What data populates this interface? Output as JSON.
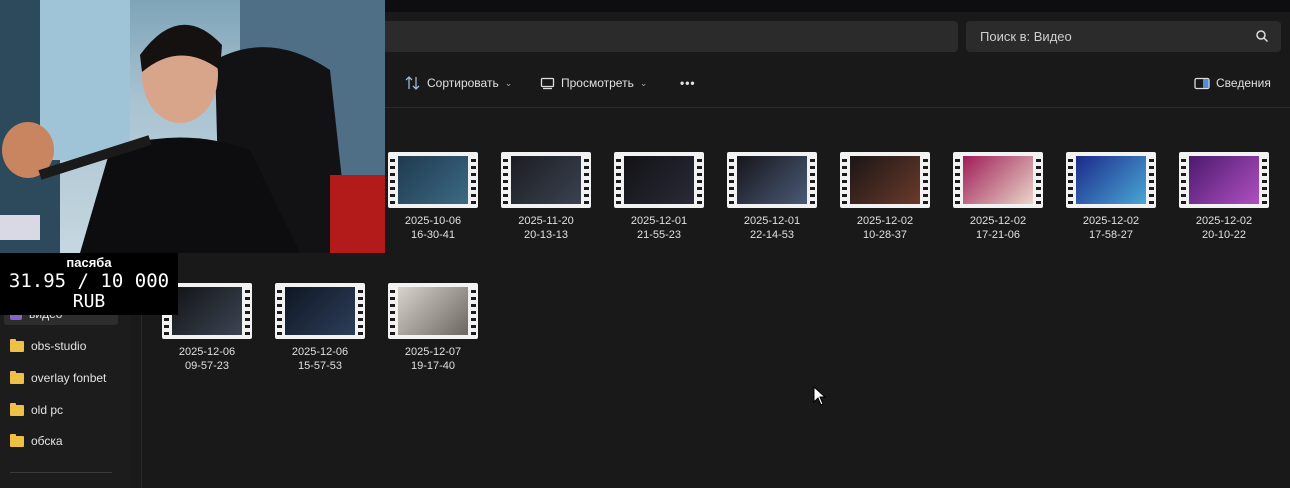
{
  "search": {
    "placeholder": "Поиск в: Видео"
  },
  "toolbar": {
    "sort_label": "Сортировать",
    "view_label": "Просмотреть",
    "more_label": "•••",
    "details_label": "Сведения"
  },
  "sidebar": {
    "items": [
      {
        "label": "видео",
        "icon": "video-folder-icon",
        "selected": true
      },
      {
        "label": "obs-studio",
        "icon": "folder-icon"
      },
      {
        "label": "overlay fonbet",
        "icon": "folder-icon"
      },
      {
        "label": "old pc",
        "icon": "folder-icon"
      },
      {
        "label": "обска",
        "icon": "folder-icon"
      }
    ]
  },
  "files": [
    {
      "date": "2025-10-06",
      "time": "16-30-41",
      "colors": [
        "#1f3a4f",
        "#3c6a84"
      ]
    },
    {
      "date": "2025-11-20",
      "time": "20-13-13",
      "colors": [
        "#1b1d22",
        "#3b4250"
      ]
    },
    {
      "date": "2025-12-01",
      "time": "21-55-23",
      "colors": [
        "#121216",
        "#2a2a38"
      ]
    },
    {
      "date": "2025-12-01",
      "time": "22-14-53",
      "colors": [
        "#16161c",
        "#4b5a76"
      ]
    },
    {
      "date": "2025-12-02",
      "time": "10-28-37",
      "colors": [
        "#1a1616",
        "#6b3a2a"
      ]
    },
    {
      "date": "2025-12-02",
      "time": "17-21-06",
      "colors": [
        "#a01c58",
        "#e9d6c8"
      ]
    },
    {
      "date": "2025-12-02",
      "time": "17-58-27",
      "colors": [
        "#1b2a8a",
        "#4aa7d6"
      ]
    },
    {
      "date": "2025-12-02",
      "time": "20-10-22",
      "colors": [
        "#4b1a6e",
        "#b04fc0"
      ]
    },
    {
      "date": "2025-12-06",
      "time": "09-57-23",
      "colors": [
        "#111316",
        "#3d4553"
      ]
    },
    {
      "date": "2025-12-06",
      "time": "15-57-53",
      "colors": [
        "#0f1724",
        "#2c3e59"
      ]
    },
    {
      "date": "2025-12-07",
      "time": "19-17-40",
      "colors": [
        "#d8d4cc",
        "#6b6660"
      ]
    }
  ],
  "overlay": {
    "title": "пасяба",
    "amount": "31.95 / 10 000",
    "currency": "RUB"
  }
}
